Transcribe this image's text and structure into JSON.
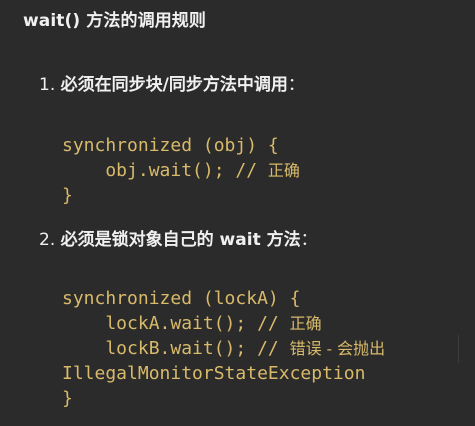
{
  "title": "wait() 方法的调用规则",
  "rules": [
    {
      "number": "1.",
      "heading": "必须在同步块/同步方法中调用",
      "colon": "：",
      "code": [
        "synchronized (obj) {",
        "    obj.wait(); // ",
        "}"
      ],
      "comments": [
        "",
        "正确",
        ""
      ]
    },
    {
      "number": "2.",
      "heading": "必须是锁对象自己的 wait 方法",
      "colon": "：",
      "code": [
        "synchronized (lockA) {",
        "    lockA.wait(); // ",
        "    lockB.wait(); // ",
        "IllegalMonitorStateException",
        "}"
      ],
      "comments": [
        "",
        "正确",
        "错误 - 会抛出",
        "",
        ""
      ]
    }
  ]
}
